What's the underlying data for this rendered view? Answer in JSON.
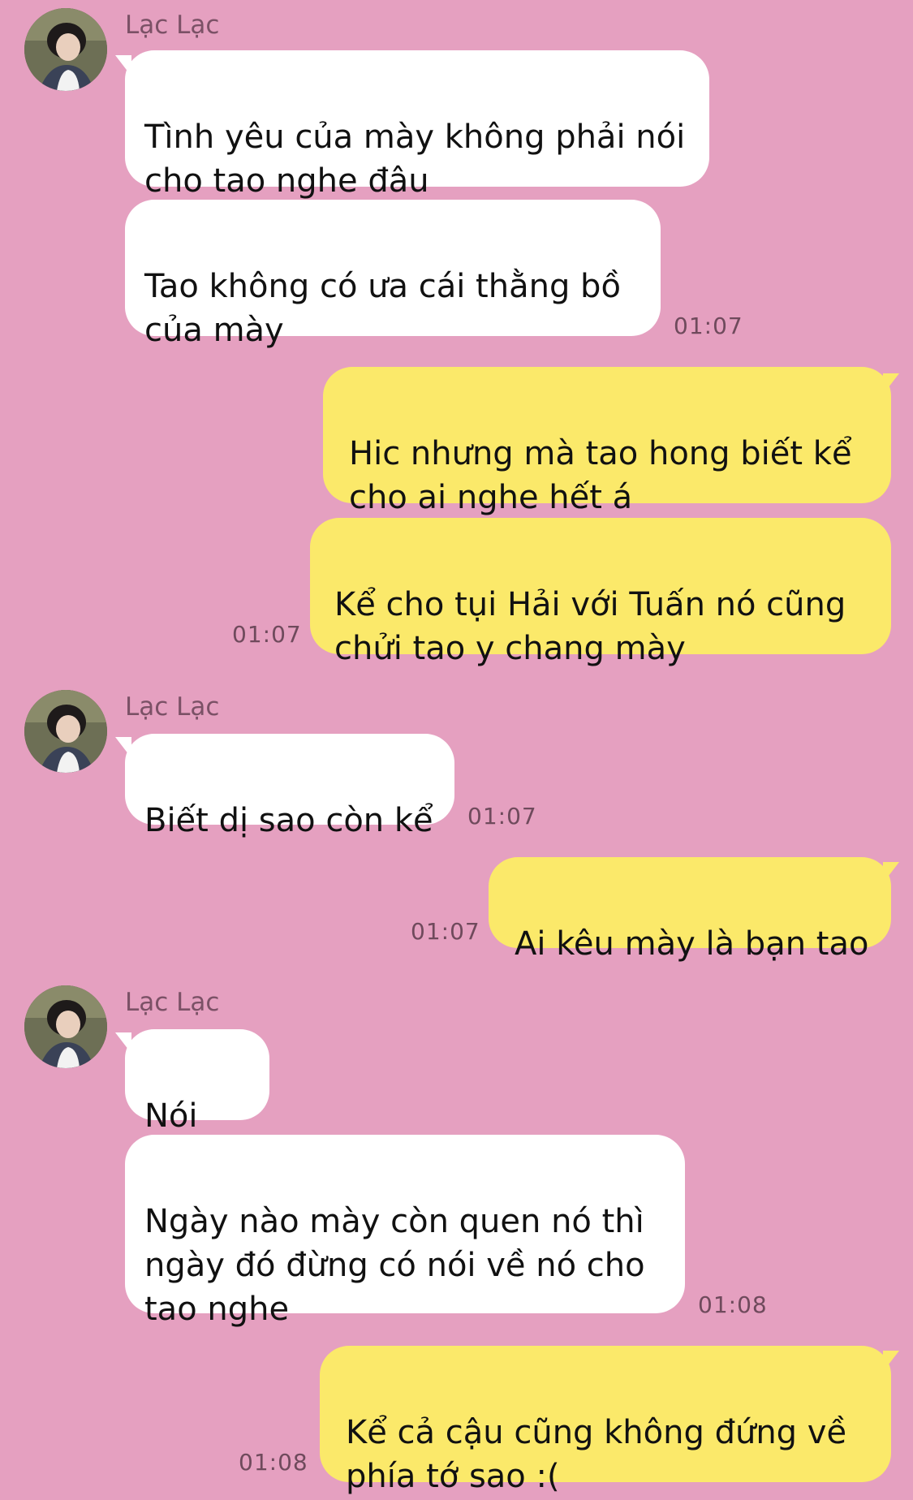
{
  "contact": {
    "name": "Lạc Lạc"
  },
  "messages": [
    {
      "from": "them",
      "text": "Tình yêu của mày không phải nói\ncho tao nghe đâu",
      "emoji": "smirk-emoji"
    },
    {
      "from": "them",
      "text": "Tao không có ưa cái thằng bồ\ncủa mày",
      "time": "01:07"
    },
    {
      "from": "me",
      "text": "Hic nhưng mà tao hong biết kể\ncho ai nghe hết á"
    },
    {
      "from": "me",
      "text": "Kể cho tụi Hải với Tuấn nó cũng\nchửi tao y chang mày",
      "time": "01:07"
    },
    {
      "from": "them",
      "text": "Biết dị sao còn kể",
      "time": "01:07"
    },
    {
      "from": "me",
      "text": "Ai kêu mày là bạn tao",
      "time": "01:07"
    },
    {
      "from": "them",
      "text": "Nói rồi"
    },
    {
      "from": "them",
      "text": "Ngày nào mày còn quen nó thì\nngày đó đừng có nói về nó cho\ntao nghe",
      "time": "01:08"
    },
    {
      "from": "me",
      "text": "Kể cả cậu cũng không đứng về\nphía tớ sao :(",
      "time": "01:08"
    }
  ],
  "colors": {
    "background": "#e5a0c0",
    "incoming_bubble": "#ffffff",
    "outgoing_bubble": "#fbe96a"
  }
}
